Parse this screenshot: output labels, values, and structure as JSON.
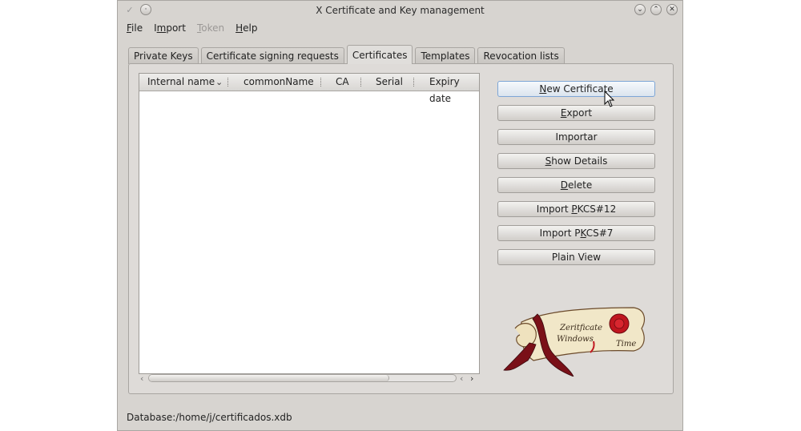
{
  "window": {
    "title": "X Certificate and Key management"
  },
  "menu": {
    "file": {
      "u": "F",
      "rest": "ile"
    },
    "import": {
      "pre": "I",
      "u": "m",
      "rest": "port"
    },
    "token": {
      "u": "T",
      "rest": "oken"
    },
    "help": {
      "u": "H",
      "rest": "elp"
    }
  },
  "tabs": [
    "Private Keys",
    "Certificate signing requests",
    "Certificates",
    "Templates",
    "Revocation lists"
  ],
  "table": {
    "columns": [
      "Internal name",
      "commonName",
      "CA",
      "Serial",
      "Expiry date"
    ]
  },
  "buttons": {
    "new": {
      "pre": "",
      "u": "N",
      "rest": "ew Certificate"
    },
    "export": {
      "pre": "",
      "u": "E",
      "rest": "xport"
    },
    "importar": {
      "pre": "",
      "u": "",
      "rest": "Importar"
    },
    "details": {
      "pre": "",
      "u": "S",
      "rest": "how Details"
    },
    "delete": {
      "pre": "",
      "u": "D",
      "rest": "elete"
    },
    "pkcs12": {
      "pre": "Import ",
      "u": "P",
      "rest": "KCS#12"
    },
    "pkcs7": {
      "pre": "Import P",
      "u": "K",
      "rest": "CS#7"
    },
    "plain": {
      "pre": "",
      "u": "",
      "rest": "Plain View"
    }
  },
  "logo": {
    "line1": "Zeritficate",
    "line2": "Windows",
    "line3": "Time"
  },
  "status": "Database:/home/j/certificados.xdb",
  "colors": {
    "accent": "#7ea6d6",
    "seal": "#c0161f",
    "ribbon": "#7a1018",
    "parchment": "#f1e7c8"
  }
}
